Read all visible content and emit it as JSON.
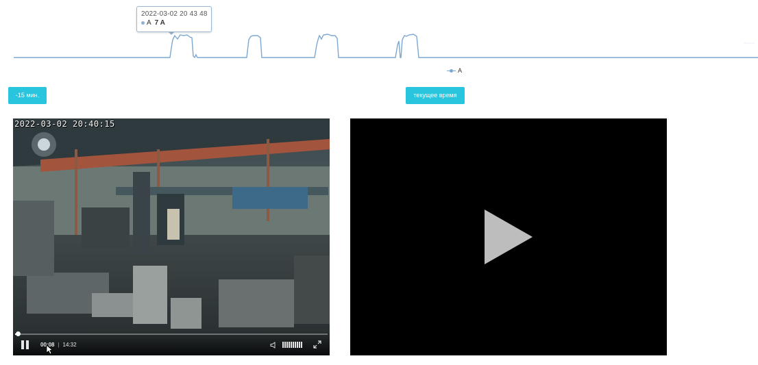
{
  "chart_data": {
    "type": "line",
    "series": [
      {
        "name": "A"
      }
    ],
    "legend": {
      "placement": "bottom-center",
      "entries": [
        "A"
      ]
    },
    "tooltip": {
      "timestamp": "2022-03-02 20 43 48",
      "series": "A",
      "value": "7 A"
    },
    "grid": false,
    "colors": {
      "line": "#7ca7d0"
    }
  },
  "buttons": {
    "back": "-15 мин.",
    "now": "текущее время"
  },
  "player_left": {
    "overlay_timestamp": "2022-03-02 20:40:15",
    "current_time": "00:08",
    "duration": "14:32",
    "progress": 0.0092,
    "icons": [
      "pause-icon",
      "volume-icon",
      "fullscreen-icon"
    ]
  },
  "player_right": {
    "icons": [
      "play-icon"
    ]
  }
}
